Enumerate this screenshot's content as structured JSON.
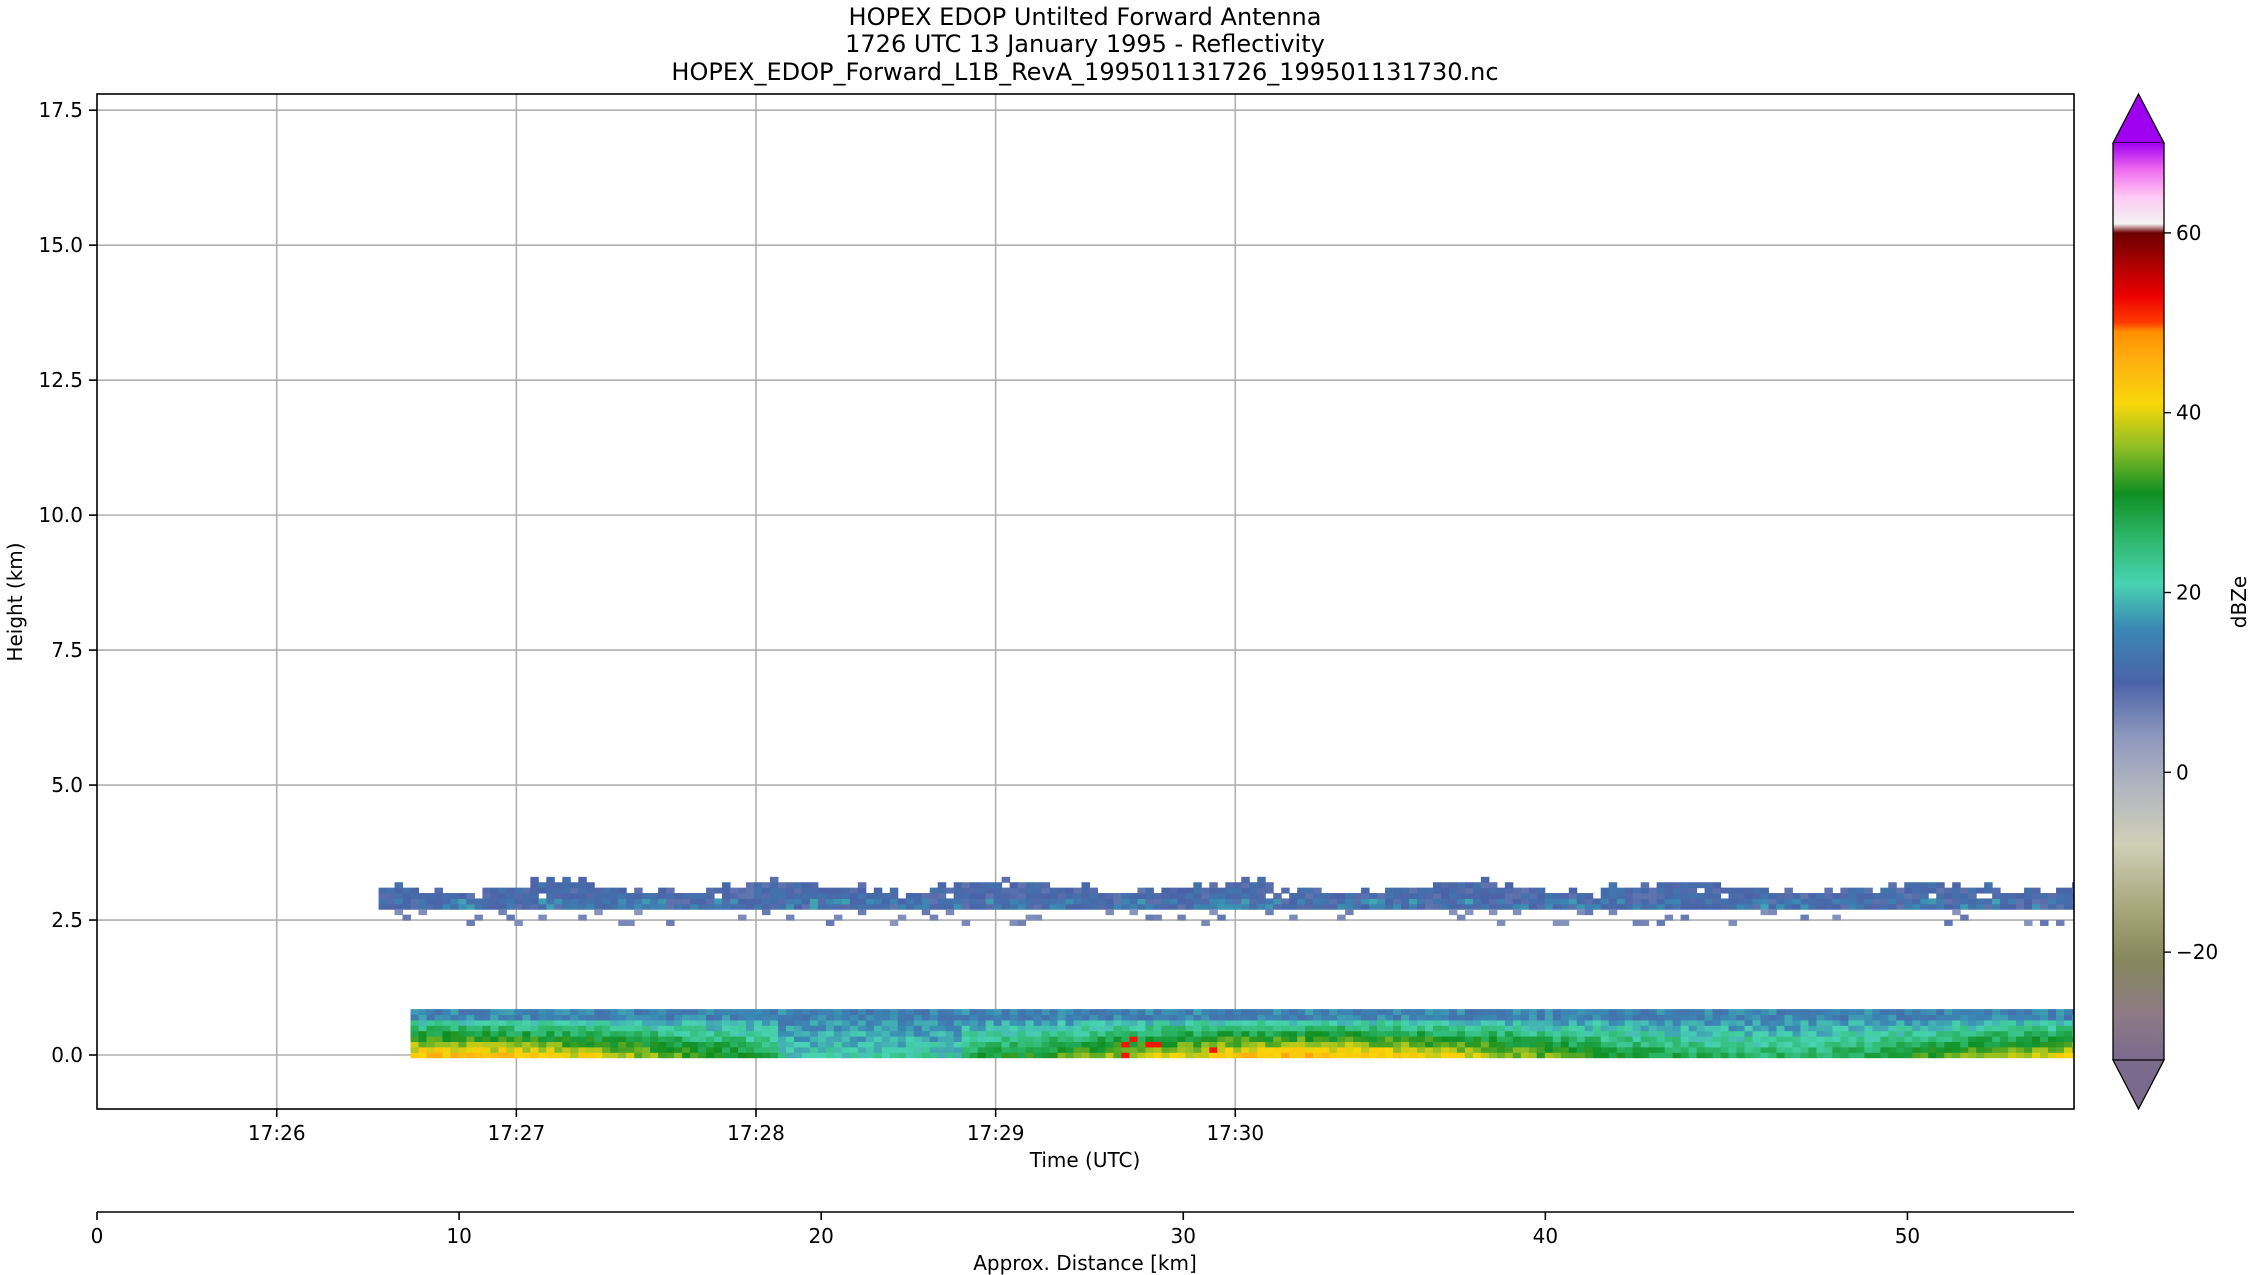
{
  "chart_data": {
    "type": "heatmap",
    "title_lines": [
      "HOPEX EDOP Untilted Forward Antenna",
      "1726 UTC 13 January 1995 - Reflectivity",
      "HOPEX_EDOP_Forward_L1B_RevA_199501131726_199501131730.nc"
    ],
    "xlabel": "Time (UTC)",
    "ylabel": "Height (km)",
    "x2label": "Approx. Distance [km]",
    "colorbar_label": "dBZe",
    "grid": true,
    "x_time_range_sec": [
      -45,
      450
    ],
    "x_time_ticks": [
      {
        "sec": 0,
        "label": "17:26"
      },
      {
        "sec": 60,
        "label": "17:27"
      },
      {
        "sec": 120,
        "label": "17:28"
      },
      {
        "sec": 180,
        "label": "17:29"
      },
      {
        "sec": 240,
        "label": "17:30"
      }
    ],
    "ylim": [
      -1.0,
      17.8
    ],
    "y_ticks": [
      {
        "v": 0.0,
        "label": "0.0"
      },
      {
        "v": 2.5,
        "label": "2.5"
      },
      {
        "v": 5.0,
        "label": "5.0"
      },
      {
        "v": 7.5,
        "label": "7.5"
      },
      {
        "v": 10.0,
        "label": "10.0"
      },
      {
        "v": 12.5,
        "label": "12.5"
      },
      {
        "v": 15.0,
        "label": "15.0"
      },
      {
        "v": 17.5,
        "label": "17.5"
      }
    ],
    "distance_range_km": [
      0,
      54.6
    ],
    "distance_ticks": [
      {
        "v": 0,
        "label": "0"
      },
      {
        "v": 10,
        "label": "10"
      },
      {
        "v": 20,
        "label": "20"
      },
      {
        "v": 30,
        "label": "30"
      },
      {
        "v": 40,
        "label": "40"
      },
      {
        "v": 50,
        "label": "50"
      }
    ],
    "colorbar_range": [
      -32,
      70
    ],
    "colorbar_extend": "both",
    "colorbar_ticks": [
      {
        "v": -20,
        "label": "−20"
      },
      {
        "v": 0,
        "label": "0"
      },
      {
        "v": 20,
        "label": "20"
      },
      {
        "v": 40,
        "label": "40"
      },
      {
        "v": 60,
        "label": "60"
      }
    ],
    "colormap": [
      {
        "v": -32,
        "c": "#7a6a8c"
      },
      {
        "v": -27,
        "c": "#8d7a86"
      },
      {
        "v": -21,
        "c": "#85875c"
      },
      {
        "v": -15,
        "c": "#a7a87c"
      },
      {
        "v": -8,
        "c": "#cfcfb7"
      },
      {
        "v": -2,
        "c": "#b3b7bf"
      },
      {
        "v": 4,
        "c": "#8e98be"
      },
      {
        "v": 10,
        "c": "#4a63a8"
      },
      {
        "v": 16,
        "c": "#3a88b4"
      },
      {
        "v": 21,
        "c": "#49d3b2"
      },
      {
        "v": 26,
        "c": "#2db76a"
      },
      {
        "v": 31,
        "c": "#0f8f23"
      },
      {
        "v": 36,
        "c": "#8bbd25"
      },
      {
        "v": 41,
        "c": "#f7d70a"
      },
      {
        "v": 46,
        "c": "#ffae10"
      },
      {
        "v": 49,
        "c": "#ff8f00"
      },
      {
        "v": 50,
        "c": "#ff3c00"
      },
      {
        "v": 53,
        "c": "#ee0000"
      },
      {
        "v": 57,
        "c": "#a40000"
      },
      {
        "v": 60,
        "c": "#6e0000"
      },
      {
        "v": 61,
        "c": "#f2f2f2"
      },
      {
        "v": 64,
        "c": "#ffcaf4"
      },
      {
        "v": 67,
        "c": "#f06cf0"
      },
      {
        "v": 70,
        "c": "#a000f0"
      }
    ],
    "layers": [
      {
        "name": "cloud-top",
        "t_start": 25.5,
        "t_end": 450,
        "y_bottom": 2.7,
        "y_top": 3.05,
        "dbz": 10
      },
      {
        "name": "precip-near-surface",
        "t_start": 33.5,
        "t_end": 450,
        "y_bottom": -0.05,
        "y_top": 0.75,
        "dbz": 32
      }
    ]
  }
}
